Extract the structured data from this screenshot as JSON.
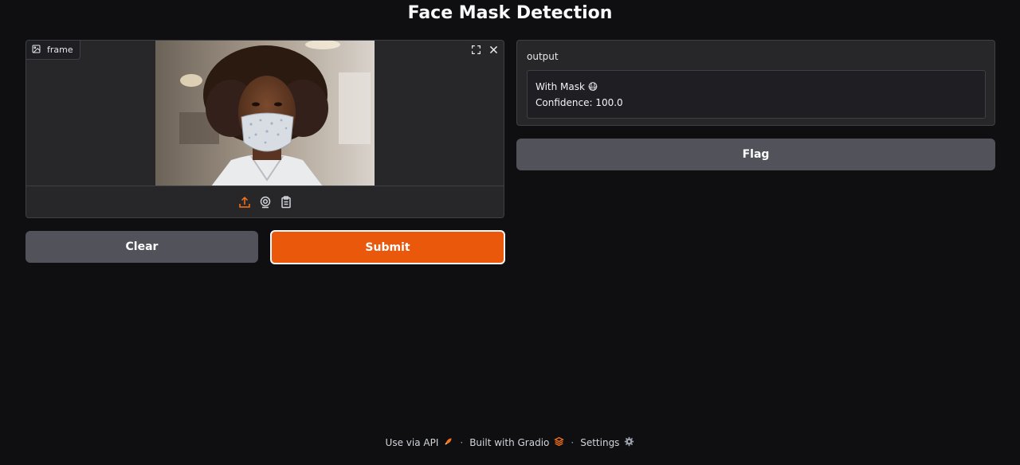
{
  "app": {
    "title": "Face Mask Detection"
  },
  "input": {
    "label": "frame",
    "label_icon": "image-icon",
    "tools": [
      "fullscreen-icon",
      "close-icon"
    ],
    "sources": [
      "upload-icon",
      "webcam-icon",
      "clipboard-icon"
    ],
    "active_source": "upload-icon"
  },
  "actions": {
    "clear_label": "Clear",
    "submit_label": "Submit",
    "flag_label": "Flag"
  },
  "output": {
    "label": "output",
    "line1": "With Mask 😷",
    "line2": "Confidence: 100.0"
  },
  "footer": {
    "api_label": "Use via API",
    "gradio_label": "Built with Gradio",
    "settings_label": "Settings",
    "separator": "·"
  },
  "colors": {
    "background": "#0f0f11",
    "panel": "#27272a",
    "accent": "#ea580c",
    "secondary_button": "#52525b"
  }
}
